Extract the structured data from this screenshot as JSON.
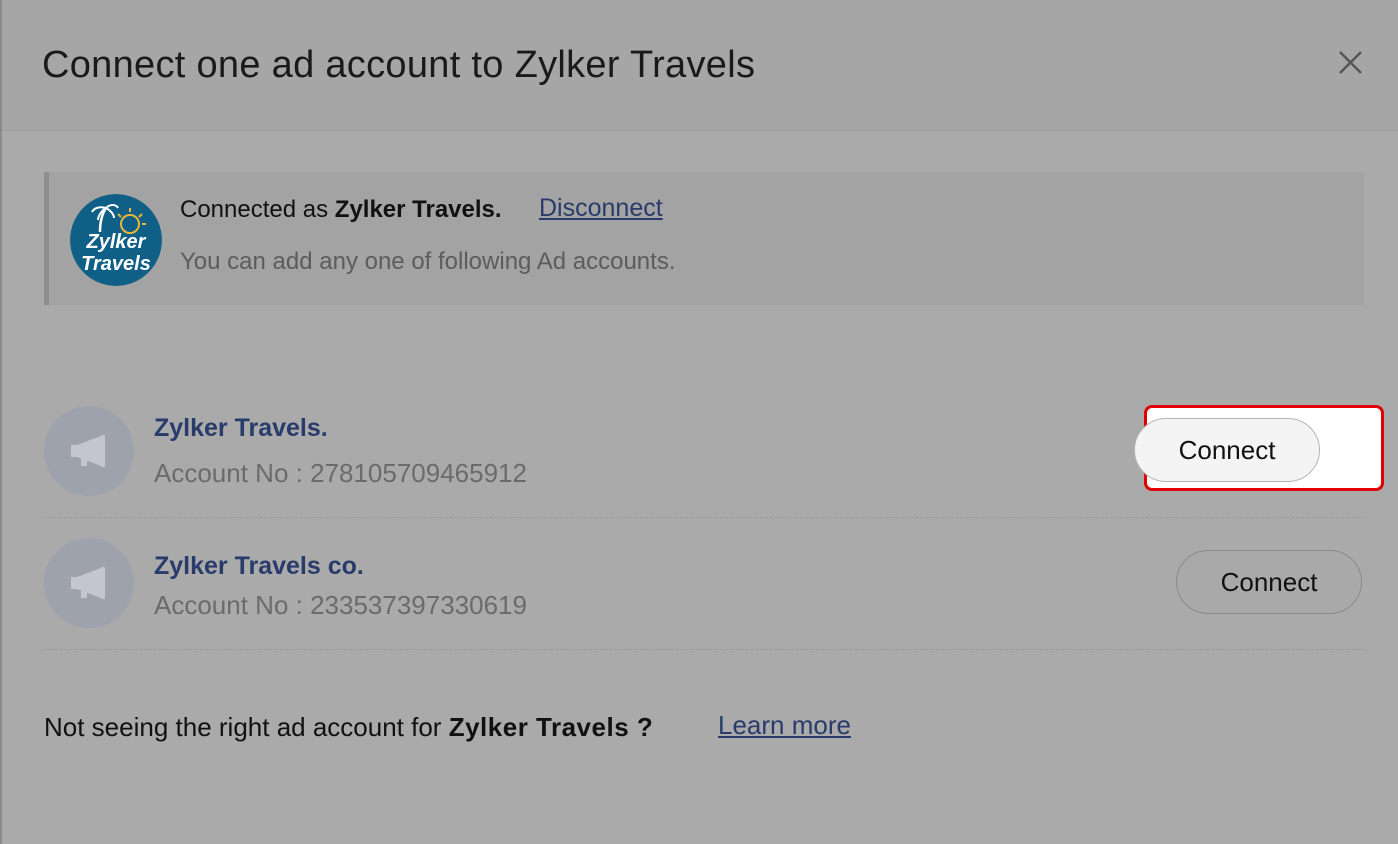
{
  "dialog": {
    "title": "Connect one ad account to Zylker Travels",
    "close_icon": "close-icon"
  },
  "connection": {
    "prefix": "Connected as ",
    "account_name": "Zylker Travels.",
    "disconnect_label": "Disconnect",
    "helper": "You can add any one of following Ad accounts.",
    "logo_text_line1": "Zylker",
    "logo_text_line2": "Travels",
    "logo_colors": {
      "background": "#0f5f86",
      "text": "#ffffff",
      "sun": "#e8b43a"
    }
  },
  "accounts": [
    {
      "name": "Zylker Travels.",
      "number": "Account No : 278105709465912",
      "connect_label": "Connect",
      "highlighted": true
    },
    {
      "name": "Zylker Travels co.",
      "number": "Account No : 233537397330619",
      "connect_label": "Connect",
      "highlighted": false
    }
  ],
  "footer": {
    "prefix": "Not seeing the right ad account for ",
    "account_name": "Zylker Travels ?",
    "learn_more_label": "Learn more"
  },
  "colors": {
    "link": "#283b6b",
    "highlight": "#e00000"
  }
}
